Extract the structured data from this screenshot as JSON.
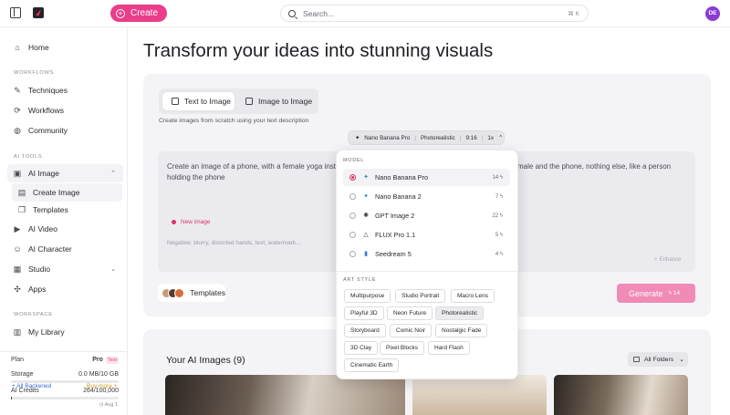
{
  "topbar": {
    "create_label": "Create",
    "search_placeholder": "Search...",
    "search_shortcut": "⌘ K",
    "avatar_initials": "DE"
  },
  "sidebar": {
    "home": "Home",
    "workflows_section": "WORKFLOWS",
    "techniques": "Techniques",
    "workflows": "Workflows",
    "community": "Community",
    "ai_tools_section": "AI TOOLS",
    "ai_image": "AI Image",
    "create_image": "Create Image",
    "templates": "Templates",
    "ai_video": "AI Video",
    "ai_character": "AI Character",
    "studio": "Studio",
    "apps": "Apps",
    "workspace_section": "WORKSPACE",
    "my_library": "My Library",
    "plan_label": "Plan",
    "plan_value": "Pro",
    "plan_badge": "Test",
    "storage_label": "Storage",
    "storage_value": "0.0 MB/10 GB",
    "storage_fraction": 0.0,
    "credits_label": "AI Credits",
    "credits_value": "264/100,000",
    "credits_fraction": 0.003,
    "credits_reset": "Aug 1",
    "cut_left": "+ All Backened",
    "cut_right": "Buy more +"
  },
  "main": {
    "heading": "Transform your ideas into stunning visuals",
    "tab_text_to_image": "Text to Image",
    "tab_image_to_image": "Image to Image",
    "subtitle": "Create images from scratch using your text description",
    "model_chip": {
      "model": "Nano Banana Pro",
      "style": "Photorealistic",
      "ratio": "9:16",
      "count": "1x"
    },
    "prompt_left": "Create an image of a phone, with a female yoga instru",
    "prompt_left_2": "holding the phone",
    "prompt_right": "male and the phone, nothing else, like a person",
    "new_image": "New image",
    "negative_placeholder": "Negative: blurry, distorted hands, text, watermark...",
    "enhance": "Enhance",
    "templates_btn": "Templates",
    "generate": "Generate",
    "generate_cost": "14"
  },
  "gallery": {
    "title": "Your AI Images (9)",
    "folders": "All Folders"
  },
  "dropdown": {
    "model_section": "MODEL",
    "models": [
      {
        "name": "Nano Banana Pro",
        "cost": "14 ϟ",
        "icon": "sparkle-icon",
        "selected": true
      },
      {
        "name": "Nano Banana 2",
        "cost": "7 ϟ",
        "icon": "sparkle-icon",
        "selected": false
      },
      {
        "name": "GPT Image 2",
        "cost": "22 ϟ",
        "icon": "openai-icon",
        "selected": false
      },
      {
        "name": "FLUX Pro 1.1",
        "cost": "5 ϟ",
        "icon": "flux-icon",
        "selected": false
      },
      {
        "name": "Seedream 5",
        "cost": "4 ϟ",
        "icon": "bars-icon",
        "selected": false
      }
    ],
    "style_section": "ART STYLE",
    "styles": [
      "Multipurpose",
      "Studio Portrait",
      "Macro Lens",
      "Playful 3D",
      "Neon Future",
      "Photorealistic",
      "Storyboard",
      "Comic Noir",
      "Nostalgic Fade",
      "3D Clay",
      "Pixel Blocks",
      "Hard Flash",
      "Cinematic Earth"
    ],
    "selected_style": "Photorealistic"
  },
  "colors": {
    "accent": "#ea3e8a",
    "generate_disabled": "#f08ab7"
  }
}
